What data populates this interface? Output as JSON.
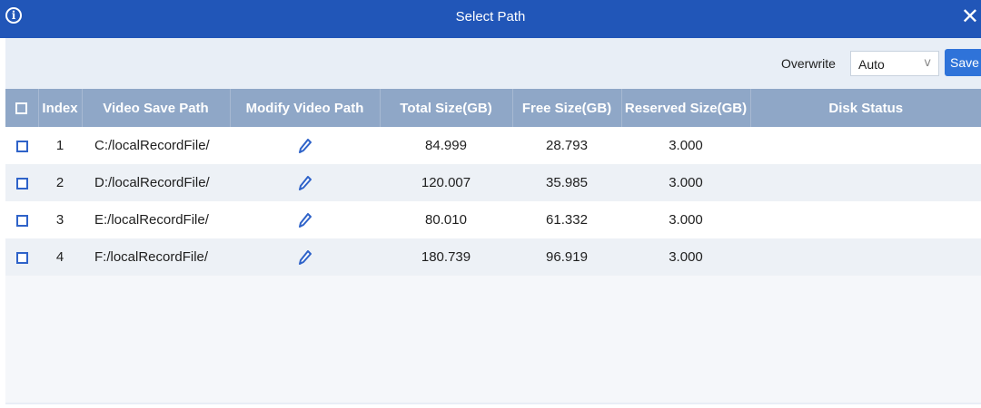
{
  "window": {
    "title": "Select Path",
    "info_icon": "info-icon",
    "close_icon": "close-icon",
    "info_glyph": "i",
    "close_glyph": "✕"
  },
  "toolbar": {
    "overwrite_label": "Overwrite",
    "overwrite_value": "Auto",
    "save_label": "Save",
    "chevron_glyph": "v"
  },
  "table": {
    "headers": {
      "index": "Index",
      "video_save_path": "Video Save Path",
      "modify_video_path": "Modify Video Path",
      "total_size": "Total Size(GB)",
      "free_size": "Free Size(GB)",
      "reserved_size": "Reserved Size(GB)",
      "disk_status": "Disk Status"
    },
    "rows": [
      {
        "index": "1",
        "path": "C:/localRecordFile/",
        "total": "84.999",
        "free": "28.793",
        "reserved": "3.000",
        "status": ""
      },
      {
        "index": "2",
        "path": "D:/localRecordFile/",
        "total": "120.007",
        "free": "35.985",
        "reserved": "3.000",
        "status": ""
      },
      {
        "index": "3",
        "path": "E:/localRecordFile/",
        "total": "80.010",
        "free": "61.332",
        "reserved": "3.000",
        "status": ""
      },
      {
        "index": "4",
        "path": "F:/localRecordFile/",
        "total": "180.739",
        "free": "96.919",
        "reserved": "3.000",
        "status": ""
      }
    ]
  },
  "colors": {
    "titlebar": "#2156b8",
    "header": "#8fa7c7",
    "accent": "#2f73d9",
    "checkbox": "#2f63c9"
  },
  "icons": {
    "edit": "pencil-icon",
    "checkbox": "checkbox-icon"
  }
}
